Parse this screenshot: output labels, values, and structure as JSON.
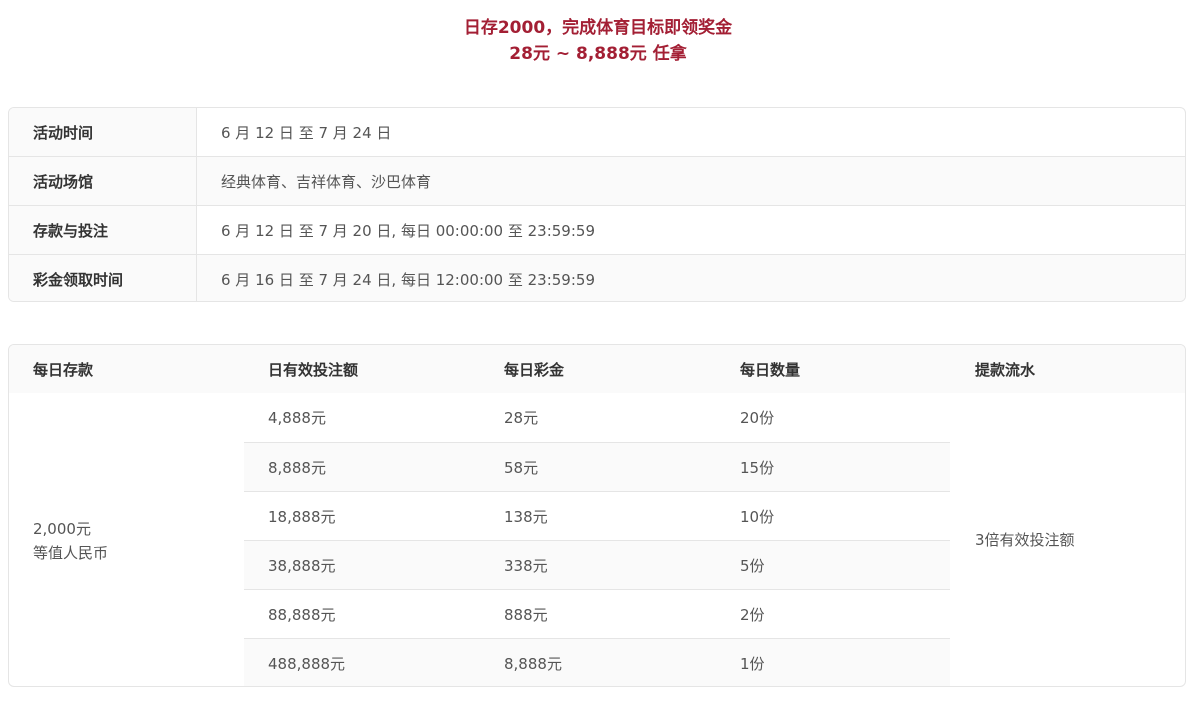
{
  "headline": {
    "line1": "日存2000，完成体育目标即领奖金",
    "line2": "28元 ~ 8,888元 任拿"
  },
  "info_table": [
    {
      "label": "活动时间",
      "value": "6 月 12 日 至 7 月 24 日"
    },
    {
      "label": "活动场馆",
      "value": "经典体育、吉祥体育、沙巴体育"
    },
    {
      "label": "存款与投注",
      "value": "6 月 12 日 至 7 月 20 日, 每日 00:00:00 至 23:59:59"
    },
    {
      "label": "彩金领取时间",
      "value": "6 月 16 日 至 7 月 24 日, 每日 12:00:00 至 23:59:59"
    }
  ],
  "reward_table": {
    "headers": [
      "每日存款",
      "日有效投注额",
      "每日彩金",
      "每日数量",
      "提款流水"
    ],
    "deposit_line1": "2,000元",
    "deposit_line2": "等值人民币",
    "turnover": "3倍有效投注额",
    "tiers": [
      {
        "bet": "4,888元",
        "bonus": "28元",
        "quantity": "20份"
      },
      {
        "bet": "8,888元",
        "bonus": "58元",
        "quantity": "15份"
      },
      {
        "bet": "18,888元",
        "bonus": "138元",
        "quantity": "10份"
      },
      {
        "bet": "38,888元",
        "bonus": "338元",
        "quantity": "5份"
      },
      {
        "bet": "88,888元",
        "bonus": "888元",
        "quantity": "2份"
      },
      {
        "bet": "488,888元",
        "bonus": "8,888元",
        "quantity": "1份"
      }
    ]
  },
  "colors": {
    "accent": "#a31f34",
    "stripe": "#fafafa",
    "border": "#e5e5e5"
  }
}
